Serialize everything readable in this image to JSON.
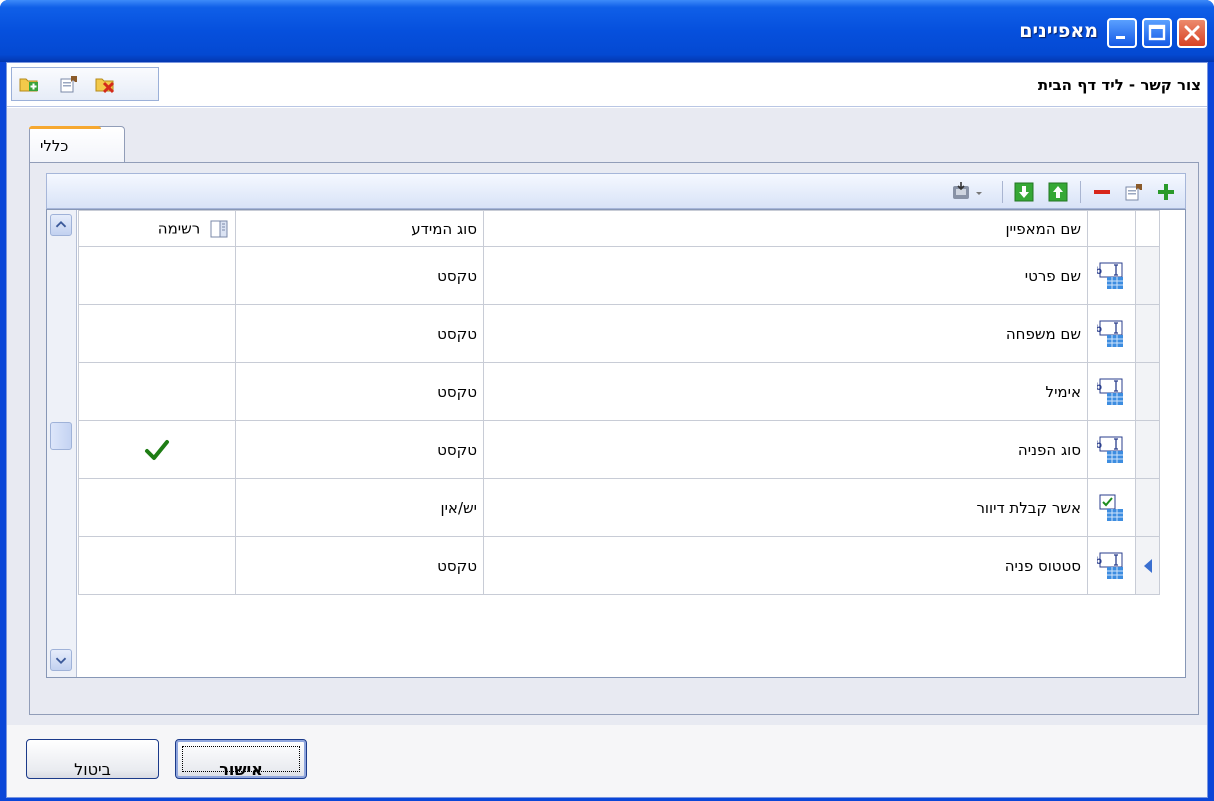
{
  "window": {
    "title": "מאפיינים",
    "buttons": {
      "minimize": "minimize-icon",
      "maximize": "maximize-icon",
      "close": "close-icon"
    }
  },
  "header": {
    "title": "צור קשר - ליד דף הבית",
    "tools": [
      "add-folder-icon",
      "properties-icon",
      "delete-folder-icon"
    ]
  },
  "tabs": [
    {
      "label": "כללי",
      "active": true
    }
  ],
  "toolstrip": {
    "buttons": [
      "add-icon",
      "properties-icon",
      "remove-icon",
      "move-up-icon",
      "move-down-icon",
      "export-dropdown-icon"
    ]
  },
  "grid": {
    "columns": {
      "name": "שם המאפיין",
      "type": "סוג המידע",
      "list": "רשימה"
    },
    "rows": [
      {
        "icon": "text-field-icon",
        "name": "שם פרטי",
        "type": "טקסט",
        "list": false,
        "current": false
      },
      {
        "icon": "text-field-icon",
        "name": "שם משפחה",
        "type": "טקסט",
        "list": false,
        "current": false
      },
      {
        "icon": "text-field-icon",
        "name": "אימיל",
        "type": "טקסט",
        "list": false,
        "current": false
      },
      {
        "icon": "text-field-icon",
        "name": "סוג הפניה",
        "type": "טקסט",
        "list": true,
        "current": false
      },
      {
        "icon": "checkbox-field-icon",
        "name": "אשר קבלת דיוור",
        "type": "יש/אין",
        "list": false,
        "current": false
      },
      {
        "icon": "text-field-icon",
        "name": "סטטוס פניה",
        "type": "טקסט",
        "list": false,
        "current": true
      }
    ]
  },
  "footer": {
    "ok_label": "אישור",
    "cancel_label": "ביטול"
  },
  "colors": {
    "titlebar": "#0650dd",
    "checkmark": "#1e7d14",
    "tab_accent": "#f6a830"
  }
}
